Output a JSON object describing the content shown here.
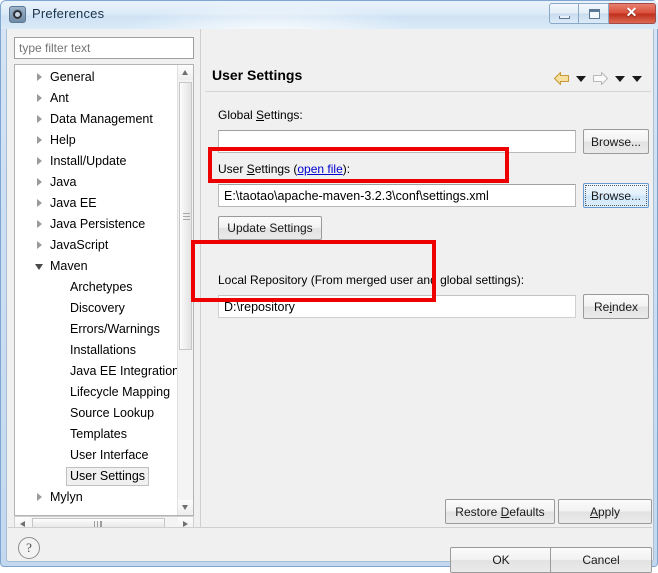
{
  "window": {
    "title": "Preferences",
    "icon": "gear-icon",
    "controls": {
      "minimize": "–",
      "maximize": "□",
      "close": "✕"
    }
  },
  "sidebar": {
    "filter": {
      "value": "",
      "placeholder": "type filter text"
    },
    "items": [
      {
        "label": "General",
        "expandable": true,
        "expanded": false,
        "child": false,
        "selected": false
      },
      {
        "label": "Ant",
        "expandable": true,
        "expanded": false,
        "child": false,
        "selected": false
      },
      {
        "label": "Data Management",
        "expandable": true,
        "expanded": false,
        "child": false,
        "selected": false
      },
      {
        "label": "Help",
        "expandable": true,
        "expanded": false,
        "child": false,
        "selected": false
      },
      {
        "label": "Install/Update",
        "expandable": true,
        "expanded": false,
        "child": false,
        "selected": false
      },
      {
        "label": "Java",
        "expandable": true,
        "expanded": false,
        "child": false,
        "selected": false
      },
      {
        "label": "Java EE",
        "expandable": true,
        "expanded": false,
        "child": false,
        "selected": false
      },
      {
        "label": "Java Persistence",
        "expandable": true,
        "expanded": false,
        "child": false,
        "selected": false
      },
      {
        "label": "JavaScript",
        "expandable": true,
        "expanded": false,
        "child": false,
        "selected": false
      },
      {
        "label": "Maven",
        "expandable": true,
        "expanded": true,
        "child": false,
        "selected": false
      },
      {
        "label": "Archetypes",
        "expandable": false,
        "expanded": false,
        "child": true,
        "selected": false
      },
      {
        "label": "Discovery",
        "expandable": false,
        "expanded": false,
        "child": true,
        "selected": false
      },
      {
        "label": "Errors/Warnings",
        "expandable": false,
        "expanded": false,
        "child": true,
        "selected": false
      },
      {
        "label": "Installations",
        "expandable": false,
        "expanded": false,
        "child": true,
        "selected": false
      },
      {
        "label": "Java EE Integration",
        "expandable": false,
        "expanded": false,
        "child": true,
        "selected": false
      },
      {
        "label": "Lifecycle Mapping",
        "expandable": false,
        "expanded": false,
        "child": true,
        "selected": false
      },
      {
        "label": "Source Lookup",
        "expandable": false,
        "expanded": false,
        "child": true,
        "selected": false
      },
      {
        "label": "Templates",
        "expandable": false,
        "expanded": false,
        "child": true,
        "selected": false
      },
      {
        "label": "User Interface",
        "expandable": false,
        "expanded": false,
        "child": true,
        "selected": false
      },
      {
        "label": "User Settings",
        "expandable": false,
        "expanded": false,
        "child": true,
        "selected": true
      },
      {
        "label": "Mylyn",
        "expandable": true,
        "expanded": false,
        "child": false,
        "selected": false
      }
    ]
  },
  "page": {
    "title": "User Settings",
    "nav": {
      "back_icon": "back-arrow-icon",
      "back_menu_icon": "chevron-down-icon",
      "forward_icon": "forward-arrow-icon",
      "forward_menu_icon": "chevron-down-icon",
      "view_menu_icon": "chevron-down-icon"
    },
    "global_settings": {
      "label_prefix": "Global ",
      "label_mnemonic": "S",
      "label_suffix": "ettings:",
      "value": "",
      "browse_label": "Browse..."
    },
    "user_settings": {
      "label_prefix": "User ",
      "label_mnemonic": "S",
      "label_mid": "ettings (",
      "open_file_link": "open file",
      "label_suffix": "):",
      "value": "E:\\taotao\\apache-maven-3.2.3\\conf\\settings.xml",
      "browse_label": "Browse...",
      "update_label": "Update Settings"
    },
    "local_repository": {
      "label": "Local Repository (From merged user and global settings):",
      "value": "D:\\repository",
      "reindex_prefix": "Re",
      "reindex_mnemonic": "i",
      "reindex_suffix": "ndex"
    },
    "restore_defaults": {
      "prefix": "Restore ",
      "mnemonic": "D",
      "suffix": "efaults"
    },
    "apply": {
      "prefix": "",
      "mnemonic": "A",
      "suffix": "pply"
    }
  },
  "footer": {
    "help_icon": "question-mark-icon",
    "ok_label": "OK",
    "cancel_label": "Cancel"
  },
  "annotations": {
    "highlight_color": "#ee0000",
    "boxes": [
      {
        "name": "user-settings-path-highlight"
      },
      {
        "name": "local-repository-highlight"
      }
    ]
  }
}
